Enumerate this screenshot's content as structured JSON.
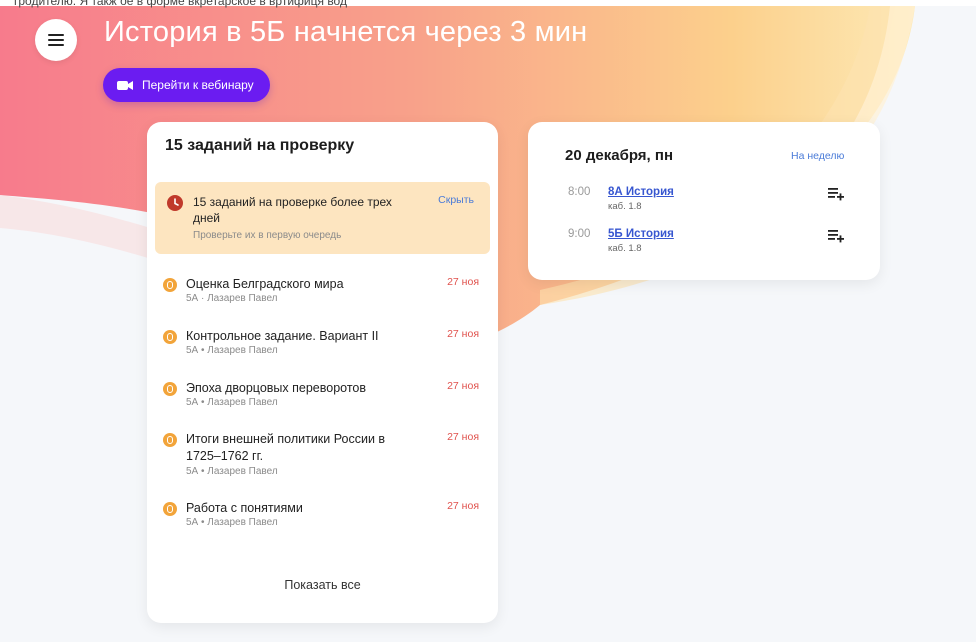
{
  "top_fragment": "гродителю. Я такж ое в форме вкретарское в вртифиця вод",
  "header": {
    "title": "История в 5Б начнется через 3 мин",
    "webinar_button": "Перейти к вебинару"
  },
  "icons": {
    "menu": "hamburger-menu-icon",
    "camera": "video-camera-icon",
    "clock": "clock-alert-icon",
    "task": "task-status-icon",
    "add": "add-to-playlist-icon"
  },
  "colors": {
    "accent": "#6b1cf1",
    "link": "#4a7bd8",
    "date_red": "#e0524d",
    "alert_bg": "#fde5c0",
    "task_badge": "#f2a43a"
  },
  "tasks": {
    "title": "15 заданий на проверку",
    "alert": {
      "title": "15 заданий на проверке более трех дней",
      "subtitle": "Проверьте их в первую очередь",
      "hide": "Скрыть"
    },
    "items": [
      {
        "title": "Оценка Белградского мира",
        "meta": "5А · Лазарев Павел",
        "date": "27 ноя"
      },
      {
        "title": "Контрольное задание. Вариант II",
        "meta": "5А • Лазарев Павел",
        "date": "27 ноя"
      },
      {
        "title": "Эпоха дворцовых переворотов",
        "meta": "5А • Лазарев Павел",
        "date": "27 ноя"
      },
      {
        "title": "Итоги внешней политики России в 1725–1762 гг.",
        "meta": "5А • Лазарев Павел",
        "date": "27 ноя"
      },
      {
        "title": "Работа с понятиями",
        "meta": "5А • Лазарев Павел",
        "date": "27 ноя"
      }
    ],
    "show_all": "Показать все"
  },
  "schedule": {
    "date": "20 декабря, пн",
    "week_link": "На неделю",
    "lessons": [
      {
        "time": "8:00",
        "title": "8А История",
        "room": "каб. 1.8"
      },
      {
        "time": "9:00",
        "title": "5Б История",
        "room": "каб. 1.8"
      }
    ]
  }
}
